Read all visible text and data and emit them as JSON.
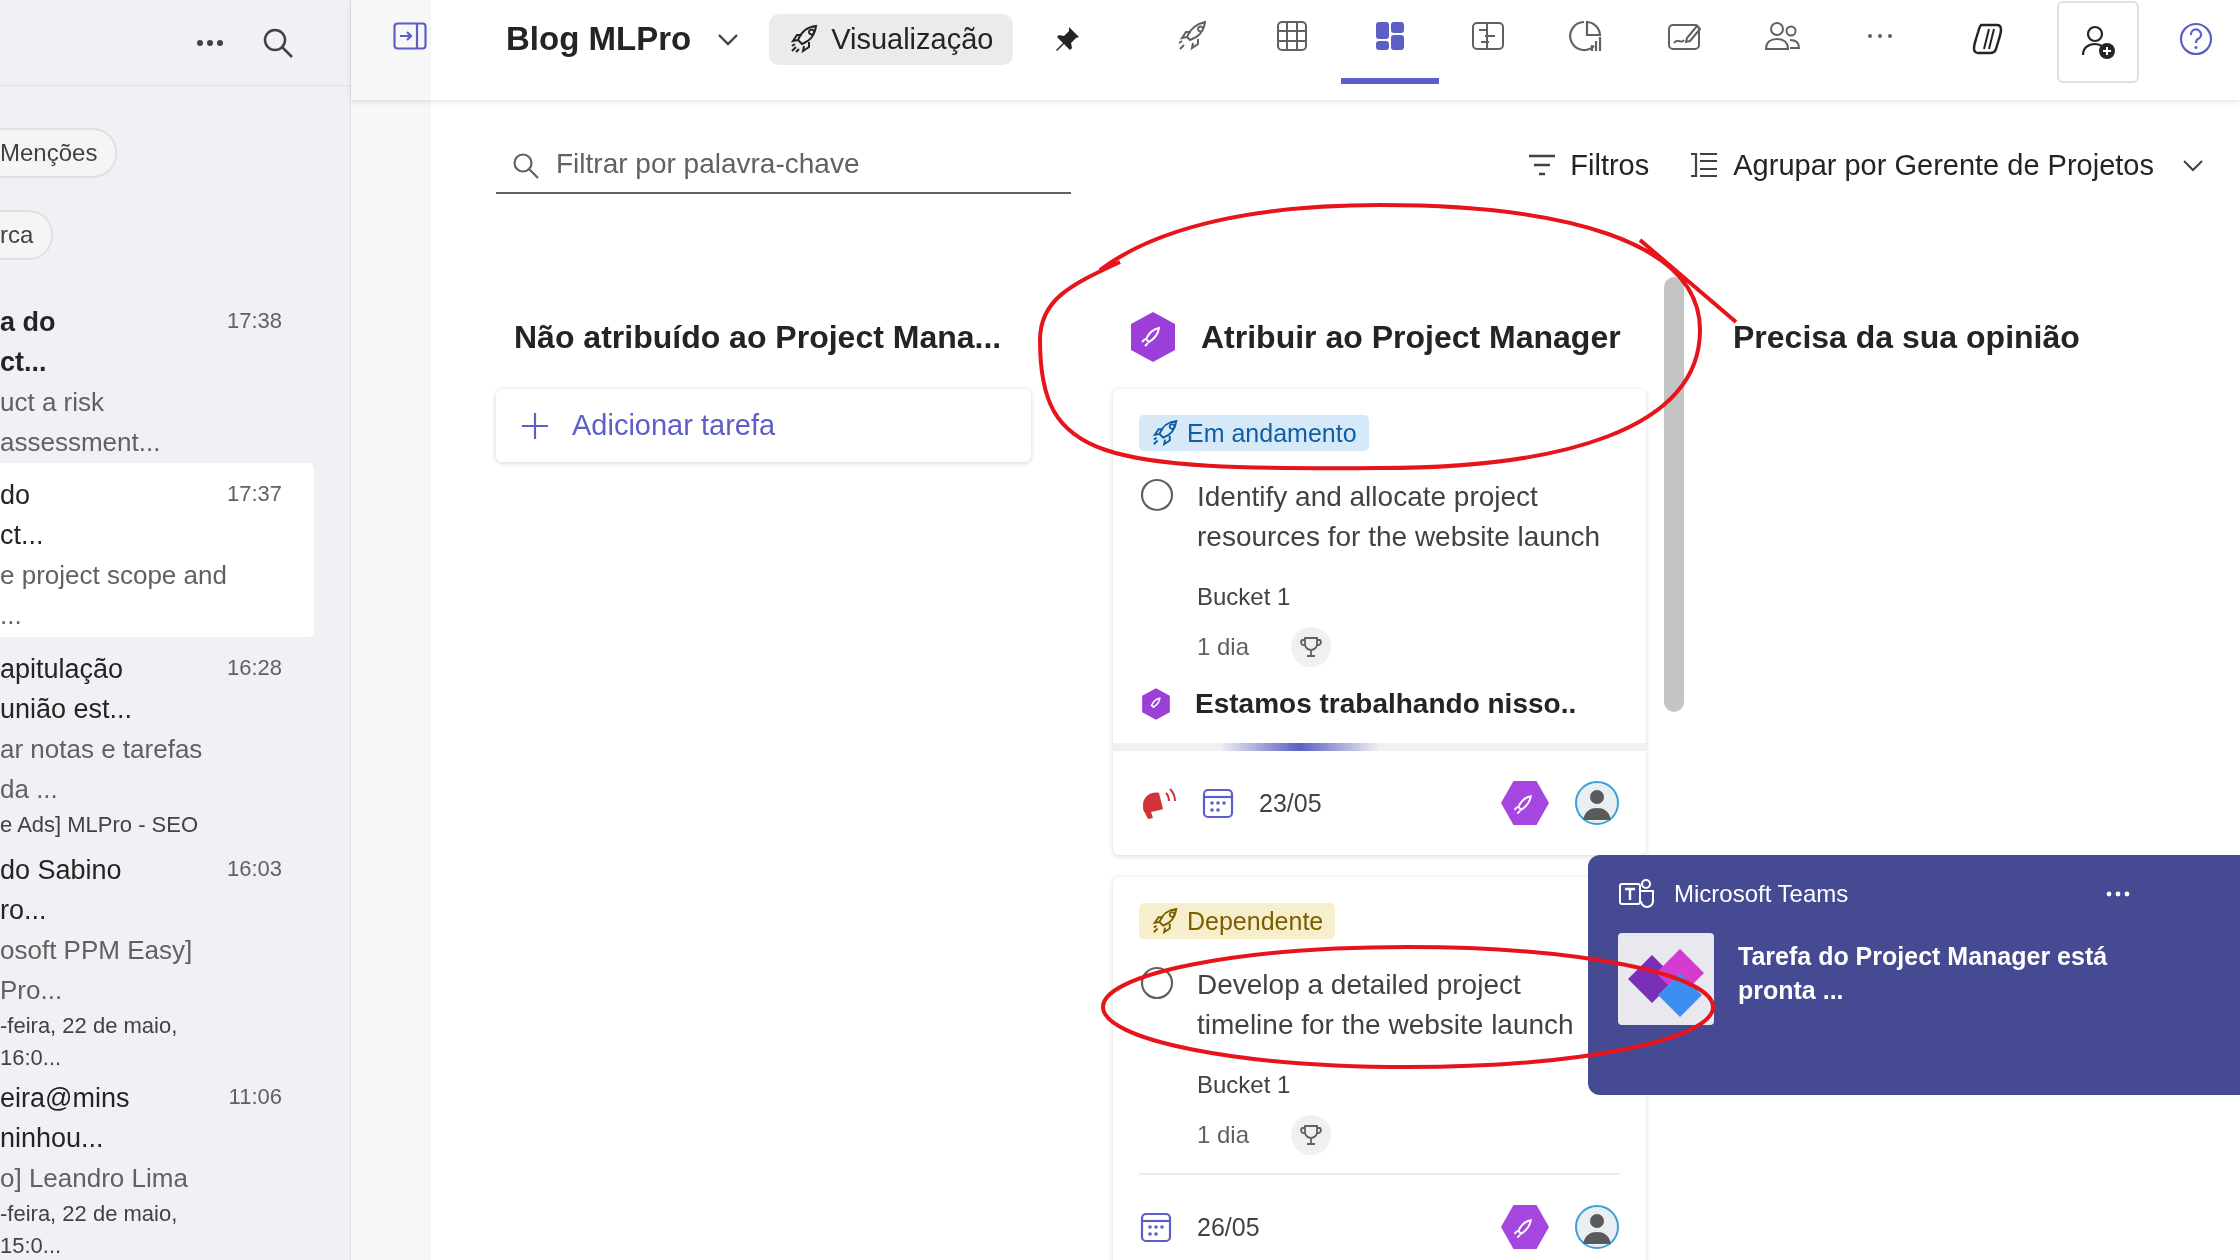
{
  "sidebar": {
    "filters": [
      {
        "label": "Menções"
      },
      {
        "label": "rca"
      }
    ],
    "items": [
      {
        "title_lines": [
          "a do",
          "ct..."
        ],
        "preview": "uct a risk assessment...",
        "time": "17:38",
        "unread": true,
        "selected": false
      },
      {
        "title_lines": [
          "do",
          "ct..."
        ],
        "preview": "e project scope and ...",
        "time": "17:37",
        "unread": false,
        "selected": true
      },
      {
        "title_lines": [
          "apitulação",
          "união est..."
        ],
        "preview": "ar notas e tarefas da ...",
        "detail": "e Ads] MLPro - SEO",
        "time": "16:28",
        "unread": false,
        "selected": false
      },
      {
        "title_lines": [
          "do Sabino",
          "ro..."
        ],
        "preview": "osoft PPM Easy] Pro...",
        "detail": "-feira, 22 de maio, 16:0...",
        "time": "16:03",
        "unread": false,
        "selected": false
      },
      {
        "title_lines": [
          "eira@mins",
          "ninhou..."
        ],
        "preview": "o] Leandro Lima",
        "detail": "-feira, 22 de maio, 15:0...",
        "time": "11:06",
        "unread": false,
        "selected": false
      }
    ]
  },
  "header": {
    "title": "Blog MLPro",
    "view_button": "Visualização",
    "tabs": [
      {
        "kind": "rocket",
        "selected": false
      },
      {
        "kind": "grid",
        "selected": false
      },
      {
        "kind": "board",
        "selected": true
      },
      {
        "kind": "schedule",
        "selected": false
      },
      {
        "kind": "chart",
        "selected": false
      },
      {
        "kind": "whiteboard",
        "selected": false
      },
      {
        "kind": "people",
        "selected": false
      },
      {
        "kind": "more",
        "selected": false
      }
    ]
  },
  "toolbar": {
    "search": {
      "placeholder": "Filtrar por palavra-chave"
    },
    "filters": "Filtros",
    "group_by": "Agrupar por Gerente de Projetos"
  },
  "board": {
    "columns": [
      {
        "title": "Não atribuído ao Project Mana...",
        "agent_icon": false,
        "add_task": "Adicionar tarefa"
      },
      {
        "title": "Atribuir ao Project Manager",
        "agent_icon": true,
        "cards": [
          {
            "tag": {
              "label": "Em andamento",
              "kind": "progress"
            },
            "completed": false,
            "title": "Identify and allocate project resources for the website launch",
            "bucket": "Bucket 1",
            "duration": "1 dia",
            "status": "Estamos trabalhando nisso..",
            "alert": true,
            "due": "23/05"
          },
          {
            "tag": {
              "label": "Dependente",
              "kind": "dependent"
            },
            "completed": false,
            "title": "Develop a detailed project timeline for the website launch",
            "bucket": "Bucket 1",
            "duration": "1 dia",
            "alert": false,
            "due": "26/05"
          }
        ]
      },
      {
        "title": "Precisa da sua opinião",
        "agent_icon": false
      }
    ]
  },
  "notification": {
    "app": "Microsoft Teams",
    "message": "Tarefa do Project Manager está pronta ..."
  }
}
